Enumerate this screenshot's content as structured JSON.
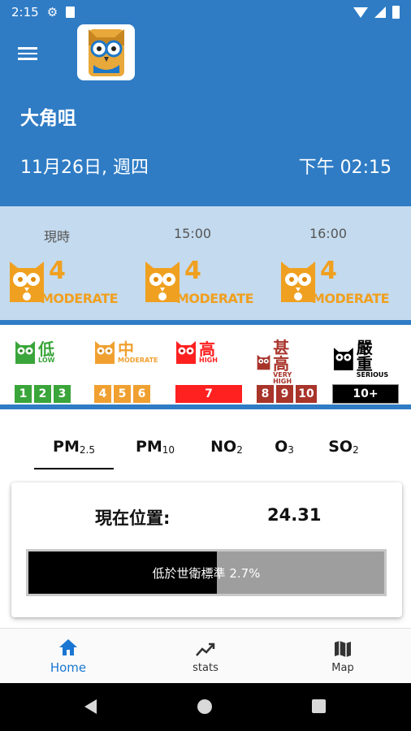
{
  "status_bar": {
    "time": "2:15"
  },
  "location": {
    "name": "大角咀",
    "date": "11月26日, 週四",
    "time": "下午 02:15"
  },
  "forecast": [
    {
      "label": "現時",
      "index": "4",
      "level": "MODERATE"
    },
    {
      "label": "15:00",
      "index": "4",
      "level": "MODERATE"
    },
    {
      "label": "16:00",
      "index": "4",
      "level": "MODERATE"
    }
  ],
  "legend": [
    {
      "cn": "低",
      "en": "LOW",
      "color": "#3aa53a",
      "boxes": [
        "1",
        "2",
        "3"
      ]
    },
    {
      "cn": "中",
      "en": "MODERATE",
      "color": "#f0a030",
      "boxes": [
        "4",
        "5",
        "6"
      ]
    },
    {
      "cn": "高",
      "en": "HIGH",
      "color": "#ff2020",
      "boxes": [
        "7"
      ]
    },
    {
      "cn": "甚高",
      "en": "VERY HIGH",
      "color": "#a8342a",
      "boxes": [
        "8",
        "9",
        "10"
      ]
    },
    {
      "cn": "嚴重",
      "en": "SERIOUS",
      "color": "#000000",
      "boxes": [
        "10+"
      ]
    }
  ],
  "tabs": [
    {
      "main": "PM",
      "sub": "2.5",
      "active": true
    },
    {
      "main": "PM",
      "sub": "10"
    },
    {
      "main": "NO",
      "sub": "2"
    },
    {
      "main": "O",
      "sub": "3"
    },
    {
      "main": "SO",
      "sub": "2"
    }
  ],
  "reading": {
    "label": "現在位置:",
    "value": "24.31",
    "bar_text": "低於世衛標準 2.7%",
    "bar_fill_fraction": 0.53
  },
  "bottom_nav": [
    {
      "label": "Home",
      "icon": "home-icon",
      "active": true
    },
    {
      "label": "stats",
      "icon": "trending-up-icon"
    },
    {
      "label": "Map",
      "icon": "map-icon"
    }
  ],
  "colors": {
    "primary": "#2f7cc5",
    "forecast_bg": "#c4daee",
    "moderate": "#f0a020",
    "active_nav": "#1976d2"
  }
}
